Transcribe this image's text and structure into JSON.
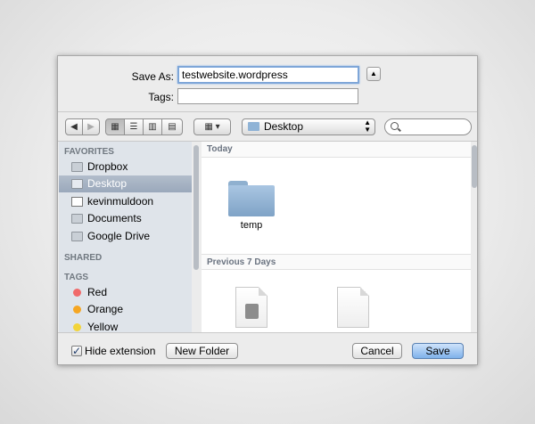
{
  "save_as": {
    "label": "Save As:",
    "value": "testwebsite.wordpress"
  },
  "tags": {
    "label": "Tags:",
    "value": ""
  },
  "toolbar": {
    "back_icon": "back-arrow",
    "forward_icon": "forward-arrow",
    "location": "Desktop"
  },
  "sidebar": {
    "favorites_header": "FAVORITES",
    "favorites": [
      {
        "label": "Dropbox",
        "icon": "folder-icon"
      },
      {
        "label": "Desktop",
        "icon": "desktop-icon",
        "selected": true
      },
      {
        "label": "kevinmuldoon",
        "icon": "home-icon"
      },
      {
        "label": "Documents",
        "icon": "folder-icon"
      },
      {
        "label": "Google Drive",
        "icon": "folder-icon"
      }
    ],
    "shared_header": "SHARED",
    "tags_header": "TAGS",
    "tags": [
      {
        "label": "Red",
        "color": "#f06a6a"
      },
      {
        "label": "Orange",
        "color": "#f5a623"
      },
      {
        "label": "Yellow",
        "color": "#f2d43a"
      }
    ]
  },
  "main": {
    "section_today": "Today",
    "today_items": [
      {
        "label": "temp"
      }
    ],
    "section_prev": "Previous 7 Days"
  },
  "bottom": {
    "hide_extension_label": "Hide extension",
    "hide_extension_checked": true,
    "new_folder_label": "New Folder",
    "cancel_label": "Cancel",
    "save_label": "Save"
  }
}
